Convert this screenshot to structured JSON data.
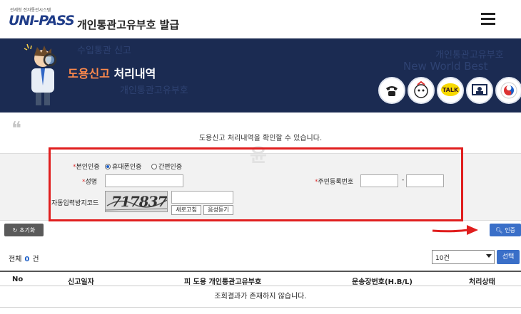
{
  "header": {
    "logo_sub": "관세청 전자통관시스템",
    "logo_main": "UNI-PASS",
    "title": "개인통관고유부호  발급"
  },
  "banner": {
    "title_highlight": "도용신고",
    "title_rest": " 처리내역",
    "ghost_texts": [
      "수입통관 신고",
      "개인통관고유부호",
      "New World Best",
      "개인통관고유부호"
    ],
    "icons": [
      "phone-icon",
      "mascot-icon",
      "kakao-talk-icon",
      "video-guide-icon",
      "customs-emblem-icon"
    ],
    "icon_talk_label": "TALK"
  },
  "notice": "도용신고 처리내역을 확인할 수 있습니다.",
  "watermark": "윤",
  "form": {
    "auth_label": "본인인증",
    "auth_options": [
      "휴대폰인증",
      "간편인증"
    ],
    "auth_selected": "휴대폰인증",
    "name_label": "성명",
    "name_value": "",
    "rrn_label": "주민등록번호",
    "rrn_separator": "-",
    "captcha_label": "자동입력방지코드",
    "captcha_text": "717837",
    "refresh_label": "새로고침",
    "audio_label": "음성듣기"
  },
  "actions": {
    "reset_label": "초기화",
    "auth_label": "인증"
  },
  "results": {
    "total_label": "전체",
    "total_count": "0",
    "total_unit": "건",
    "page_size": "10건",
    "select_label": "선택",
    "columns": [
      "No",
      "신고일자",
      "피 도용 개인통관고유부호",
      "운송장번호(H.B/L)",
      "처리상태"
    ],
    "empty_message": "조회결과가 존재하지 않습니다."
  },
  "colors": {
    "banner_bg": "#1b2b52",
    "highlight": "#ff8a4c",
    "primary_button": "#3a6fc8",
    "annotation_red": "#e01e1e"
  }
}
